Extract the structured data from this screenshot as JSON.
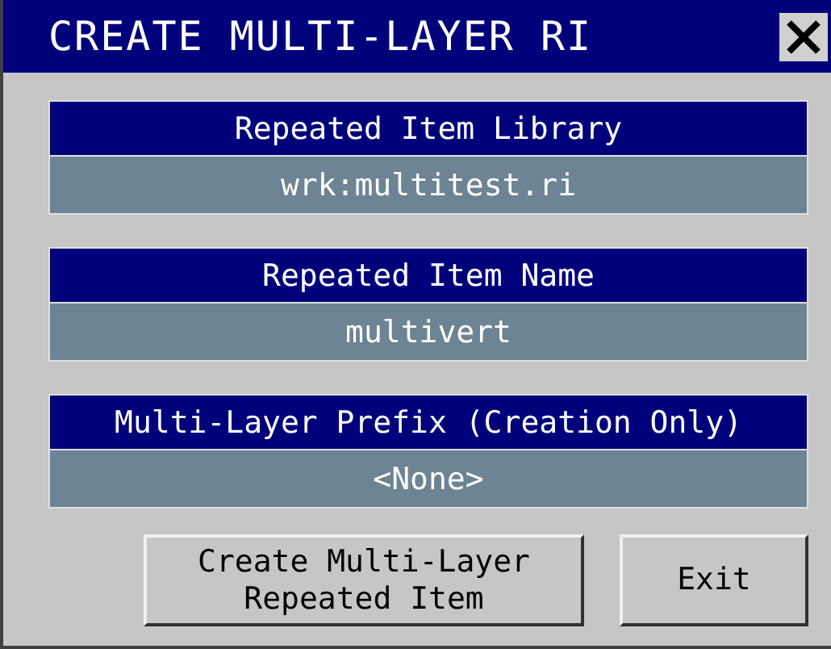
{
  "window": {
    "title": "CREATE MULTI-LAYER RI"
  },
  "fields": [
    {
      "label": "Repeated Item Library",
      "value": "wrk:multitest.ri"
    },
    {
      "label": "Repeated Item Name",
      "value": "multivert"
    },
    {
      "label": "Multi-Layer Prefix (Creation Only)",
      "value": "<None>"
    }
  ],
  "buttons": [
    {
      "label": "Create Multi-Layer\nRepeated Item"
    },
    {
      "label": "Exit"
    }
  ]
}
